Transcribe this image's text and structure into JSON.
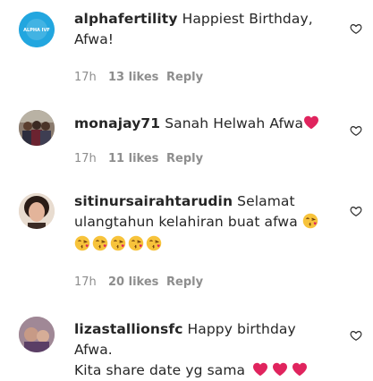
{
  "comments": [
    {
      "username": "alphafertility",
      "text_line1": "Happiest Birthday,",
      "text_line2": "Afwa!",
      "time": "17h",
      "likes": "13 likes",
      "reply": "Reply",
      "avatar_logo_text": "ALPHA IVF"
    },
    {
      "username": "monajay71",
      "text_line1": "Sanah Helwah Afwa",
      "time": "17h",
      "likes": "11 likes",
      "reply": "Reply"
    },
    {
      "username": "sitinursairahtarudin",
      "text_line1": "Selamat",
      "text_line2": "ulangtahun kelahiran buat afwa",
      "time": "17h",
      "likes": "20 likes",
      "reply": "Reply"
    },
    {
      "username": "lizastallionsfc",
      "text_line1": "Happy birthday Afwa.",
      "text_line2": "Kita share date yg sama"
    }
  ],
  "colors": {
    "heart_red": "#e0245e",
    "text": "#262626",
    "meta": "#8e8e8e",
    "logo_blue": "#21a3dc"
  },
  "icons": [
    "like-heart-outline-icon",
    "red-heart-emoji",
    "kissing-face-emoji"
  ]
}
